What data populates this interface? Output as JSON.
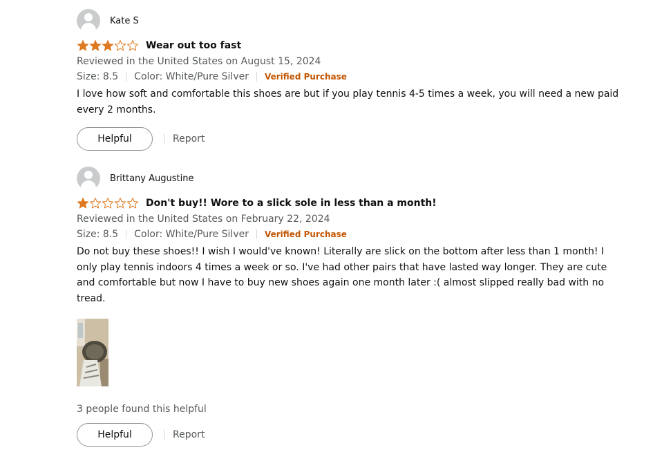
{
  "reviews": [
    {
      "profile_name": "Kate S",
      "rating": 3,
      "max_rating": 5,
      "title": "Wear out too fast",
      "date_text": "Reviewed in the United States on August 15, 2024",
      "size": "Size: 8.5",
      "color": "Color: White/Pure Silver",
      "verified": "Verified Purchase",
      "body": "I love how soft and comfortable this shoes are but if you play tennis 4-5 times a week, you will need a new paid every 2 months.",
      "helpful_label": "Helpful",
      "report_label": "Report"
    },
    {
      "profile_name": "Brittany Augustine",
      "rating": 1,
      "max_rating": 5,
      "title": "Don't buy!! Wore to a slick sole in less than a month!",
      "date_text": "Reviewed in the United States on February 22, 2024",
      "size": "Size: 8.5",
      "color": "Color: White/Pure Silver",
      "verified": "Verified Purchase",
      "body": "Do not buy these shoes!! I wish I would've known! Literally are slick on the bottom after less than 1 month! I only play tennis indoors 4 times a week or so. I've had other pairs that have lasted way longer. They are cute and comfortable but now I have to buy new shoes again one month later :( almost slipped really bad with no tread.",
      "helpful_count_text": "3 people found this helpful",
      "helpful_label": "Helpful",
      "report_label": "Report"
    }
  ],
  "colors": {
    "star_fill": "#de7921",
    "verified": "#c45500",
    "secondary_text": "#565959"
  }
}
